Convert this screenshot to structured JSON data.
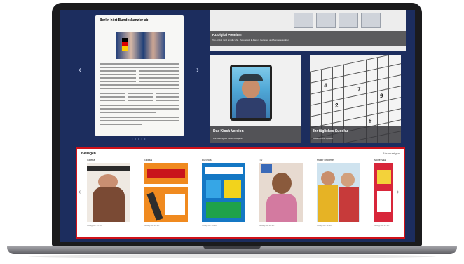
{
  "newspaper": {
    "headline": "Berlin hört Bundeskanzler ab"
  },
  "carousel": {
    "dots": "• • • • •"
  },
  "premium": {
    "title": "RZ Digital Premium",
    "description": "Top‑Artikel rund um die Uhr · Zeitung als E‑Paper · Beilagen und Sonderausgaben"
  },
  "tiles": [
    {
      "title": "Das Kiosk Version",
      "description": "Die Zeitung als Tablet‑Ausgabe",
      "icon": "tablet-icon"
    },
    {
      "title": "Ihr tägliches Sudoku",
      "description": "Rätsel online spielen",
      "icon": "grid-icon"
    }
  ],
  "supplements": {
    "title": "Beilagen",
    "show_all": "Alle anzeigen",
    "items": [
      {
        "name": "Galeria",
        "date": "Gültig bis 15.10."
      },
      {
        "name": "Globus",
        "date": "Gültig bis 14.10."
      },
      {
        "name": "Euronics",
        "date": "Gültig bis 13.10."
      },
      {
        "name": "TV",
        "date": "Gültig bis 13.10."
      },
      {
        "name": "Müller Drogerie",
        "date": "Gültig bis 12.10."
      },
      {
        "name": "Möbelhaus",
        "date": "Gültig bis 12.10."
      }
    ]
  },
  "colors": {
    "screen_bg": "#1c2d5e",
    "highlight_border": "#d0121a"
  }
}
